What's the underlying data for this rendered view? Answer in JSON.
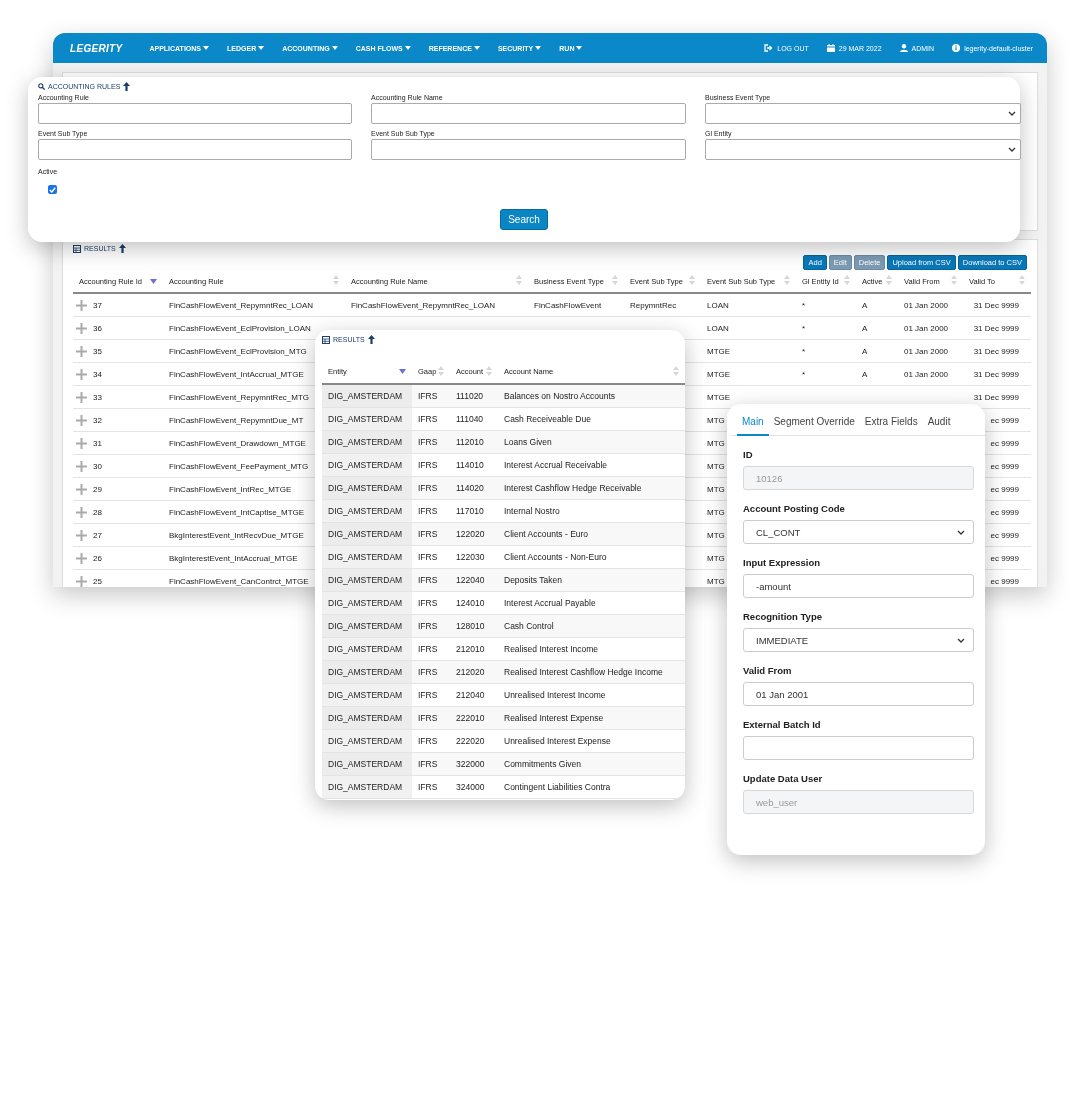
{
  "nav": {
    "brand": "LEGERITY",
    "menus": [
      "APPLICATIONS",
      "LEDGER",
      "ACCOUNTING",
      "CASH FLOWS",
      "REFERENCE",
      "SECURITY",
      "RUN"
    ],
    "right": [
      {
        "kind": "logout",
        "text": "LOG OUT"
      },
      {
        "kind": "date",
        "text": "29 MAR 2022"
      },
      {
        "kind": "user",
        "text": "ADMIN"
      },
      {
        "kind": "info",
        "text": "legerity-default-cluster"
      }
    ]
  },
  "search_panel": {
    "title": "ACCOUNTING RULES",
    "fields": [
      {
        "label": "Accounting Rule",
        "kind": "text"
      },
      {
        "label": "Accounting Rule Name",
        "kind": "text"
      },
      {
        "label": "Business Event Type",
        "kind": "select"
      },
      {
        "label": "Event Sub Type",
        "kind": "text"
      },
      {
        "label": "Event Sub Sub Type",
        "kind": "text"
      },
      {
        "label": "Gl Entity",
        "kind": "select"
      }
    ],
    "active": {
      "label": "Active",
      "checked": true
    },
    "button": "Search"
  },
  "results": {
    "title": "RESULTS",
    "buttons": [
      {
        "label": "Add",
        "disabled": false
      },
      {
        "label": "Edit",
        "disabled": true
      },
      {
        "label": "Delete",
        "disabled": true
      },
      {
        "label": "Upload from CSV",
        "disabled": false
      },
      {
        "label": "Download to CSV",
        "disabled": false
      }
    ],
    "columns": [
      {
        "label": "Accounting Rule Id",
        "sorted": true
      },
      {
        "label": "Accounting Rule",
        "sorted": false
      },
      {
        "label": "Accounting Rule Name",
        "sorted": false
      },
      {
        "label": "Business Event Type",
        "sorted": false
      },
      {
        "label": "Event Sub Type",
        "sorted": false
      },
      {
        "label": "Event Sub Sub Type",
        "sorted": false
      },
      {
        "label": "Gl Entity Id",
        "sorted": false
      },
      {
        "label": "Active",
        "sorted": false
      },
      {
        "label": "Valid From",
        "sorted": false
      },
      {
        "label": "Valid To",
        "sorted": false
      }
    ],
    "rows": [
      {
        "id": "37",
        "rule": "FinCashFlowEvent_RepymntRec_LOAN",
        "rule_name": "FinCashFlowEvent_RepymntRec_LOAN",
        "business_event_type": "FinCashFlowEvent",
        "event_sub_type": "RepymntRec",
        "event_sub_sub_type": "LOAN",
        "gl_entity_id": "*",
        "active": "A",
        "valid_from": "01 Jan 2000",
        "valid_to": "31 Dec 9999"
      },
      {
        "id": "36",
        "rule": "FinCashFlowEvent_EclProvision_LOAN",
        "event_sub_sub_type": "LOAN",
        "gl_entity_id": "*",
        "active": "A",
        "valid_from": "01 Jan 2000",
        "valid_to": "31 Dec 9999"
      },
      {
        "id": "35",
        "rule": "FinCashFlowEvent_EclProvision_MTG",
        "event_sub_sub_type": "MTGE",
        "gl_entity_id": "*",
        "active": "A",
        "valid_from": "01 Jan 2000",
        "valid_to": "31 Dec 9999"
      },
      {
        "id": "34",
        "rule": "FinCashFlowEvent_IntAccrual_MTGE",
        "event_sub_sub_type": "MTGE",
        "gl_entity_id": "*",
        "active": "A",
        "valid_from": "01 Jan 2000",
        "valid_to": "31 Dec 9999"
      },
      {
        "id": "33",
        "rule": "FinCashFlowEvent_RepymntRec_MTG",
        "event_sub_sub_type": "MTGE",
        "valid_to": "31 Dec 9999"
      },
      {
        "id": "32",
        "rule": "FinCashFlowEvent_RepymntDue_MT",
        "event_sub_sub_type": "MTG",
        "valid_to": "ec 9999"
      },
      {
        "id": "31",
        "rule": "FinCashFlowEvent_Drawdown_MTGE",
        "event_sub_sub_type": "MTG",
        "valid_to": "ec 9999"
      },
      {
        "id": "30",
        "rule": "FinCashFlowEvent_FeePayment_MTG",
        "event_sub_sub_type": "MTG",
        "valid_to": "ec 9999"
      },
      {
        "id": "29",
        "rule": "FinCashFlowEvent_IntRec_MTGE",
        "event_sub_sub_type": "MTG",
        "valid_to": "ec 9999"
      },
      {
        "id": "28",
        "rule": "FinCashFlowEvent_IntCaptlse_MTGE",
        "event_sub_sub_type": "MTG",
        "valid_to": "ec 9999"
      },
      {
        "id": "27",
        "rule": "BkgInterestEvent_IntRecvDue_MTGE",
        "event_sub_sub_type": "MTG",
        "valid_to": "ec 9999"
      },
      {
        "id": "26",
        "rule": "BkgInterestEvent_IntAccrual_MTGE",
        "event_sub_sub_type": "MTG",
        "valid_to": "ec 9999"
      },
      {
        "id": "25",
        "rule": "FinCashFlowEvent_CanContrct_MTGE",
        "event_sub_sub_type": "MTG",
        "valid_to": "ec 9999"
      }
    ]
  },
  "accounts": {
    "title": "RESULTS",
    "columns": [
      {
        "label": "Entity",
        "sorted": true
      },
      {
        "label": "Gaap",
        "sorted": false
      },
      {
        "label": "Account",
        "sorted": false
      },
      {
        "label": "Account Name",
        "sorted": false
      }
    ],
    "rows": [
      [
        "DIG_AMSTERDAM",
        "IFRS",
        "111020",
        "Balances on Nostro Accounts"
      ],
      [
        "DIG_AMSTERDAM",
        "IFRS",
        "111040",
        "Cash Receiveable Due"
      ],
      [
        "DIG_AMSTERDAM",
        "IFRS",
        "112010",
        "Loans Given"
      ],
      [
        "DIG_AMSTERDAM",
        "IFRS",
        "114010",
        "Interest Accrual Receivable"
      ],
      [
        "DIG_AMSTERDAM",
        "IFRS",
        "114020",
        "Interest Cashflow Hedge Receivable"
      ],
      [
        "DIG_AMSTERDAM",
        "IFRS",
        "117010",
        "Internal Nostro"
      ],
      [
        "DIG_AMSTERDAM",
        "IFRS",
        "122020",
        "Client Accounts - Euro"
      ],
      [
        "DIG_AMSTERDAM",
        "IFRS",
        "122030",
        "Client Accounts - Non-Euro"
      ],
      [
        "DIG_AMSTERDAM",
        "IFRS",
        "122040",
        "Deposits Taken"
      ],
      [
        "DIG_AMSTERDAM",
        "IFRS",
        "124010",
        "Interest Accrual Payable"
      ],
      [
        "DIG_AMSTERDAM",
        "IFRS",
        "128010",
        "Cash Control"
      ],
      [
        "DIG_AMSTERDAM",
        "IFRS",
        "212010",
        "Realised Interest Income"
      ],
      [
        "DIG_AMSTERDAM",
        "IFRS",
        "212020",
        "Realised Interest Cashflow Hedge Income"
      ],
      [
        "DIG_AMSTERDAM",
        "IFRS",
        "212040",
        "Unrealised Interest Income"
      ],
      [
        "DIG_AMSTERDAM",
        "IFRS",
        "222010",
        "Realised Interest Expense"
      ],
      [
        "DIG_AMSTERDAM",
        "IFRS",
        "222020",
        "Unrealised Interest Expense"
      ],
      [
        "DIG_AMSTERDAM",
        "IFRS",
        "322000",
        "Commitments Given"
      ],
      [
        "DIG_AMSTERDAM",
        "IFRS",
        "324000",
        "Contingent Liabilities Contra"
      ]
    ]
  },
  "form": {
    "tabs": [
      {
        "label": "Main",
        "selected": true
      },
      {
        "label": "Segment Override",
        "selected": false
      },
      {
        "label": "Extra Fields",
        "selected": false
      },
      {
        "label": "Audit",
        "selected": false
      }
    ],
    "fields": [
      {
        "label": "ID",
        "kind": "input",
        "value": "10126",
        "readonly": true
      },
      {
        "label": "Account Posting Code",
        "kind": "select",
        "value": "CL_CONT",
        "readonly": false
      },
      {
        "label": "Input Expression",
        "kind": "input",
        "value": "-amount",
        "readonly": false
      },
      {
        "label": "Recognition Type",
        "kind": "select",
        "value": "IMMEDIATE",
        "readonly": false
      },
      {
        "label": "Valid From",
        "kind": "input",
        "value": "01 Jan 2001",
        "readonly": false
      },
      {
        "label": "External Batch Id",
        "kind": "input",
        "readonly": false
      },
      {
        "label": "Update Data User",
        "kind": "input",
        "value": "web_user",
        "readonly": true
      }
    ]
  }
}
